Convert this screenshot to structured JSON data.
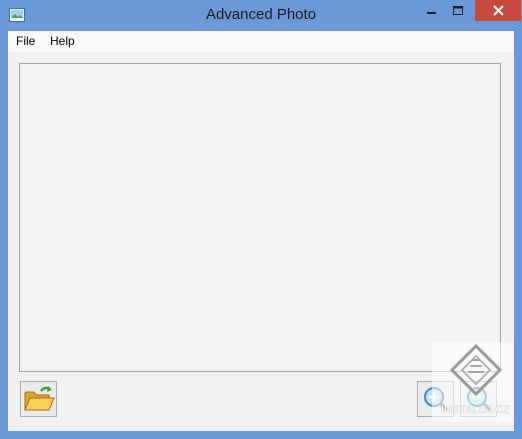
{
  "window": {
    "title": "Advanced Photo",
    "icon": "image-icon",
    "controls": {
      "minimize_icon": "minimize-icon",
      "maximize_icon": "maximize-icon",
      "close_icon": "close-icon",
      "close_color": "#c7493d"
    },
    "titlebar_color": "#6b98d6"
  },
  "menu": {
    "items": [
      {
        "label": "File"
      },
      {
        "label": "Help"
      }
    ]
  },
  "toolbar": {
    "open_icon": "open-folder-icon",
    "zoom_in_icon": "zoom-in-icon",
    "zoom_out_icon": "zoom-out-icon"
  },
  "watermark": {
    "text": "INSTALUJ.CZ"
  }
}
